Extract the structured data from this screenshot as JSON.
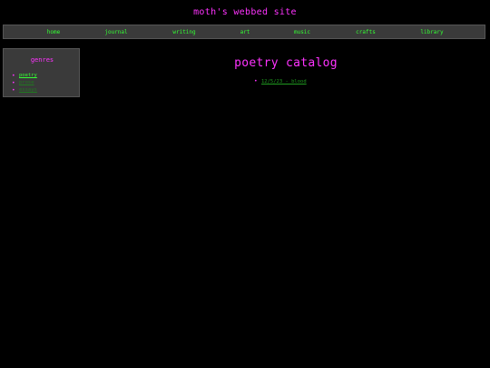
{
  "site": {
    "title": "moth's webbed site"
  },
  "nav": {
    "items": [
      {
        "label": "home"
      },
      {
        "label": "journal"
      },
      {
        "label": "writing"
      },
      {
        "label": "art"
      },
      {
        "label": "music"
      },
      {
        "label": "crafts"
      },
      {
        "label": "library"
      }
    ]
  },
  "sidebar": {
    "title": "genres",
    "items": [
      {
        "label": "poetry"
      },
      {
        "label": "prose"
      },
      {
        "label": "essays"
      }
    ]
  },
  "main": {
    "title": "poetry catalog",
    "entries": [
      {
        "label": "12/5/23 - blood"
      }
    ]
  },
  "colors": {
    "background": "#000000",
    "accent_magenta": "#ff33ff",
    "link_green": "#33ff33",
    "link_green_dim": "#1f7a1f",
    "panel_gray": "#3a3a3a"
  }
}
